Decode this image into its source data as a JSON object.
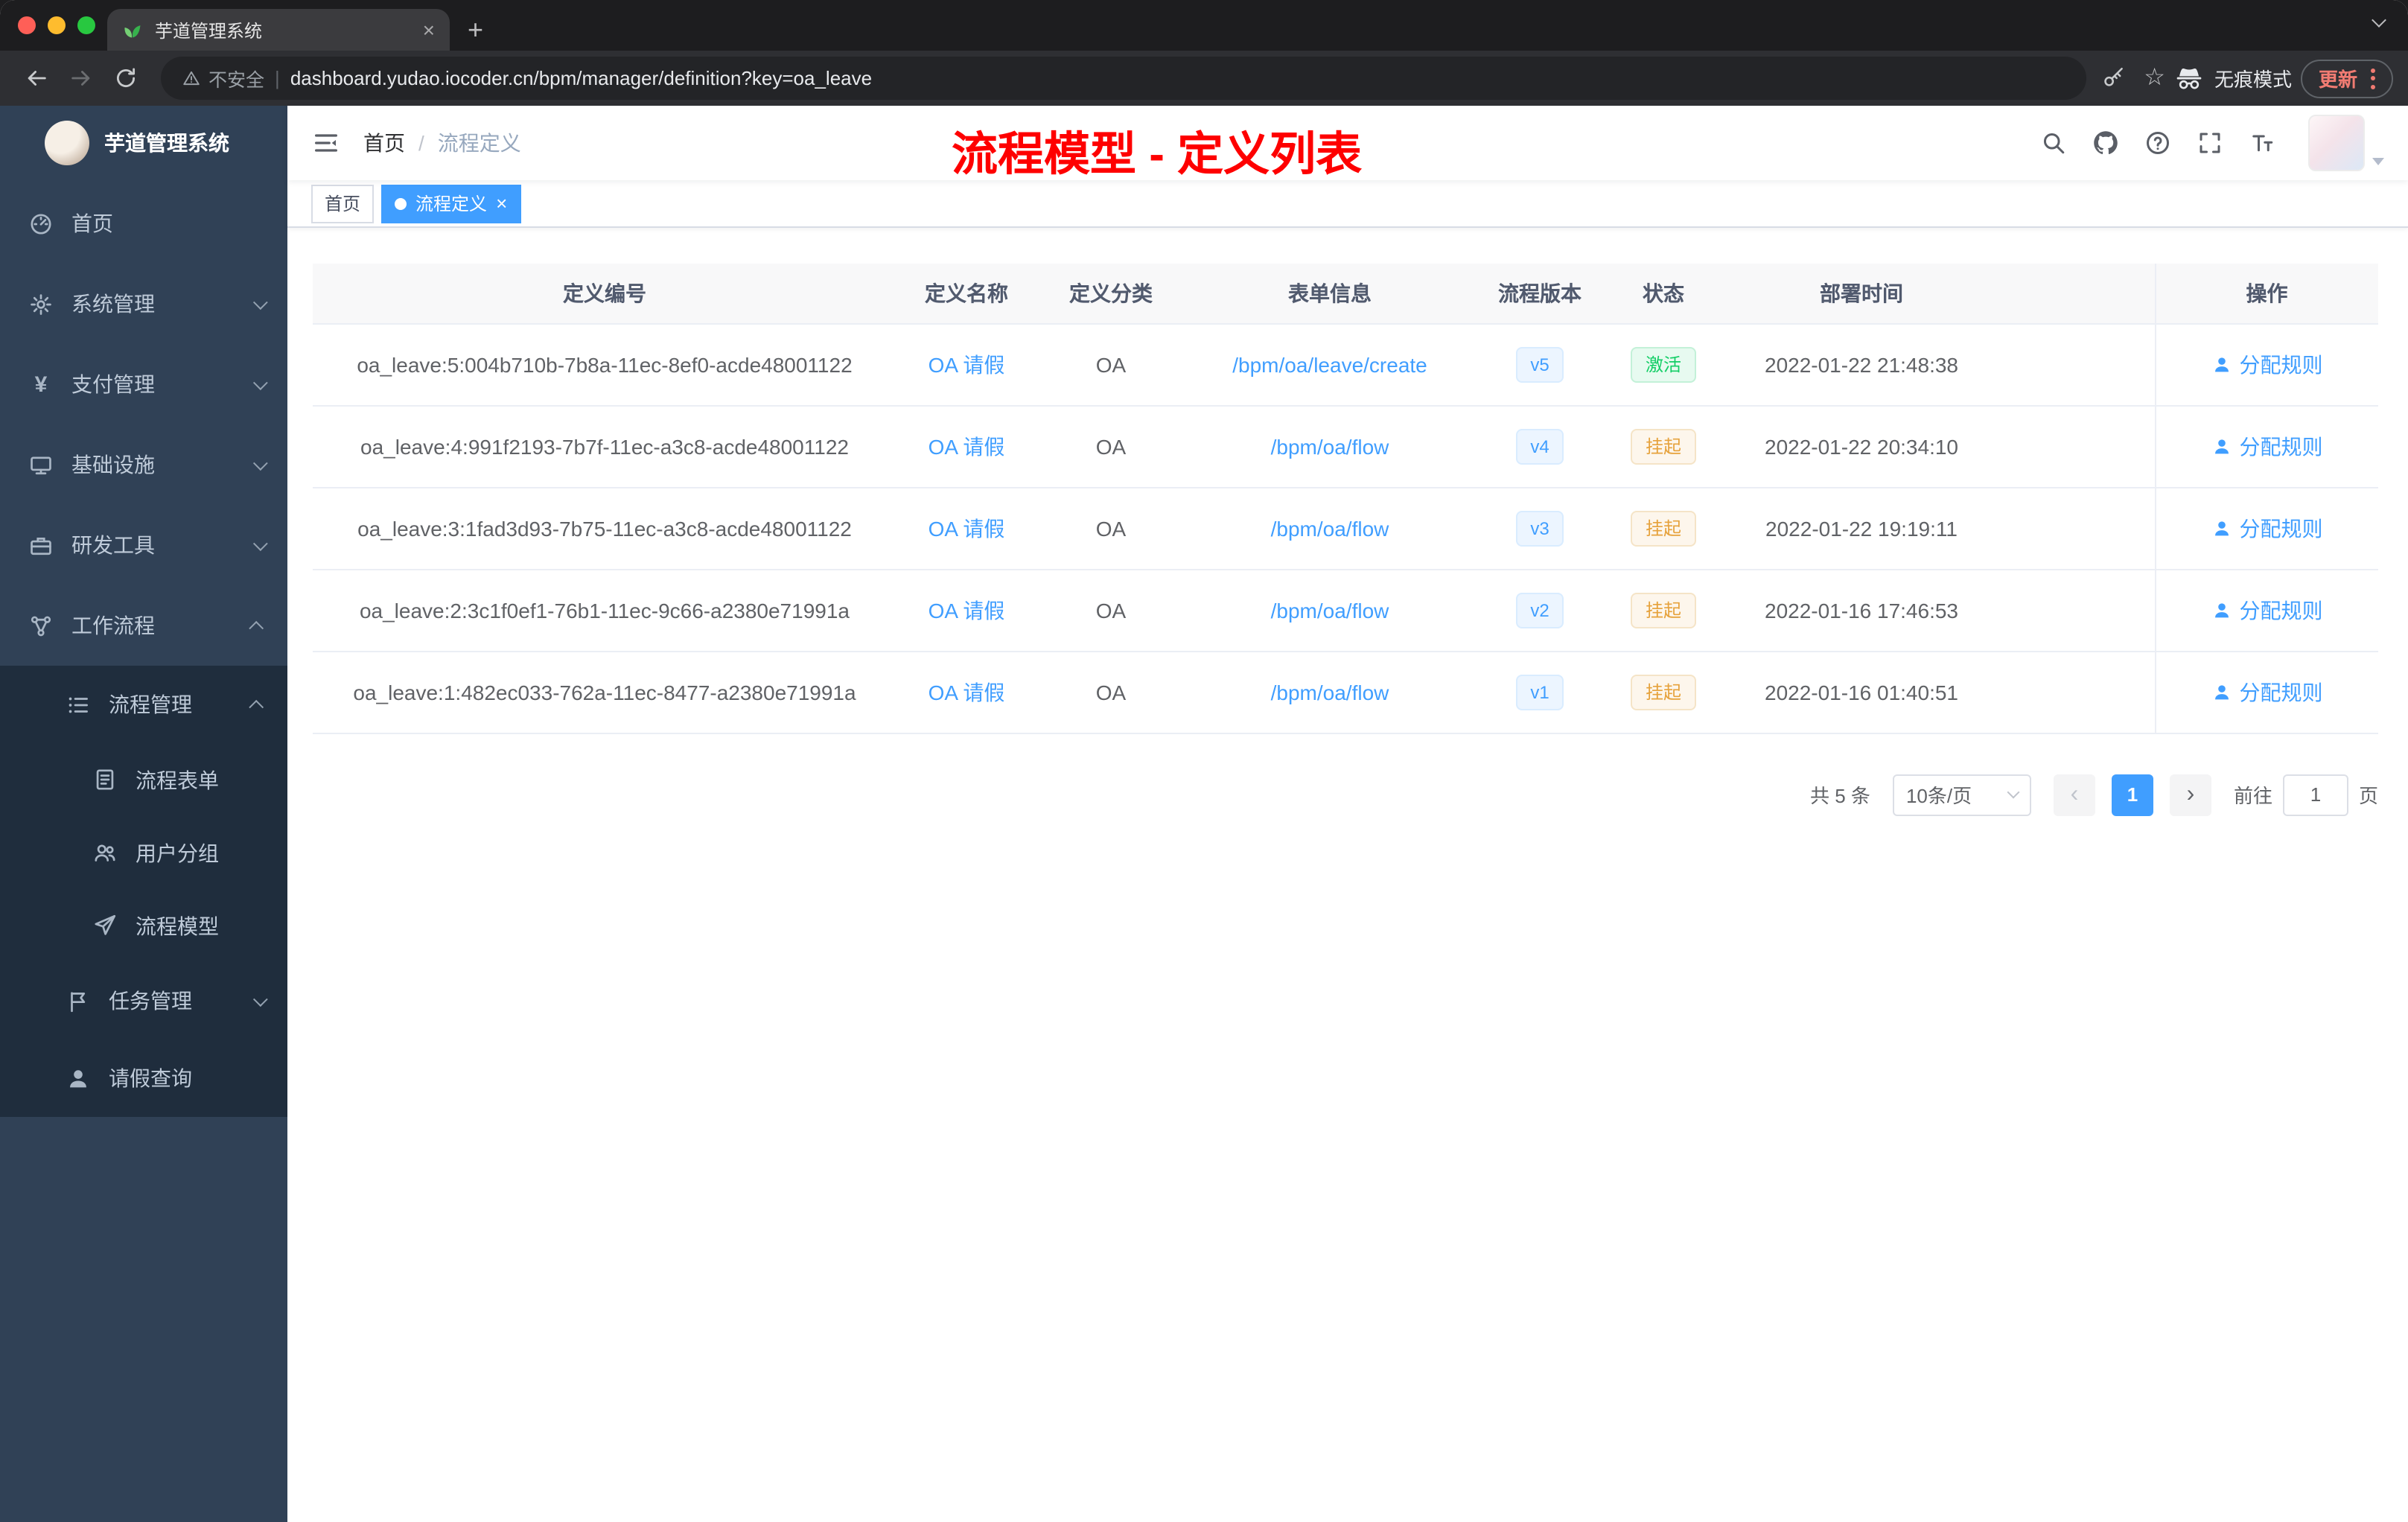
{
  "browser": {
    "tab_title": "芋道管理系统",
    "security_label": "不安全",
    "url": "dashboard.yudao.iocoder.cn/bpm/manager/definition?key=oa_leave",
    "incognito_label": "无痕模式",
    "update_label": "更新"
  },
  "sidebar": {
    "logo_title": "芋道管理系统",
    "items": [
      {
        "label": "首页"
      },
      {
        "label": "系统管理"
      },
      {
        "label": "支付管理"
      },
      {
        "label": "基础设施"
      },
      {
        "label": "研发工具"
      },
      {
        "label": "工作流程"
      },
      {
        "label": "流程管理"
      },
      {
        "label": "流程表单"
      },
      {
        "label": "用户分组"
      },
      {
        "label": "流程模型"
      },
      {
        "label": "任务管理"
      },
      {
        "label": "请假查询"
      }
    ]
  },
  "navbar": {
    "breadcrumb_home": "首页",
    "breadcrumb_separator": "/",
    "breadcrumb_current": "流程定义",
    "annotation": "流程模型 - 定义列表"
  },
  "tags": {
    "home": "首页",
    "current": "流程定义"
  },
  "table": {
    "columns": [
      "定义编号",
      "定义名称",
      "定义分类",
      "表单信息",
      "流程版本",
      "状态",
      "部署时间",
      "操作"
    ],
    "rows": [
      {
        "id": "oa_leave:5:004b710b-7b8a-11ec-8ef0-acde48001122",
        "name": "OA 请假",
        "category": "OA",
        "form": "/bpm/oa/leave/create",
        "version": "v5",
        "status": "激活",
        "time": "2022-01-22 21:48:38",
        "action": "分配规则"
      },
      {
        "id": "oa_leave:4:991f2193-7b7f-11ec-a3c8-acde48001122",
        "name": "OA 请假",
        "category": "OA",
        "form": "/bpm/oa/flow",
        "version": "v4",
        "status": "挂起",
        "time": "2022-01-22 20:34:10",
        "action": "分配规则"
      },
      {
        "id": "oa_leave:3:1fad3d93-7b75-11ec-a3c8-acde48001122",
        "name": "OA 请假",
        "category": "OA",
        "form": "/bpm/oa/flow",
        "version": "v3",
        "status": "挂起",
        "time": "2022-01-22 19:19:11",
        "action": "分配规则"
      },
      {
        "id": "oa_leave:2:3c1f0ef1-76b1-11ec-9c66-a2380e71991a",
        "name": "OA 请假",
        "category": "OA",
        "form": "/bpm/oa/flow",
        "version": "v2",
        "status": "挂起",
        "time": "2022-01-16 17:46:53",
        "action": "分配规则"
      },
      {
        "id": "oa_leave:1:482ec033-762a-11ec-8477-a2380e71991a",
        "name": "OA 请假",
        "category": "OA",
        "form": "/bpm/oa/flow",
        "version": "v1",
        "status": "挂起",
        "time": "2022-01-16 01:40:51",
        "action": "分配规则"
      }
    ]
  },
  "pagination": {
    "total": "共 5 条",
    "page_size": "10条/页",
    "prev_icon": "‹",
    "current_page": "1",
    "next_icon": "›",
    "goto_label": "前往",
    "goto_value": "1",
    "unit_label": "页"
  },
  "colors": {
    "accent": "#409eff",
    "success": "#13ce66",
    "warning": "#e6a23c",
    "annotation": "#fe0000",
    "sidebar_bg": "#304156",
    "submenu_bg": "#1f2d3d"
  }
}
